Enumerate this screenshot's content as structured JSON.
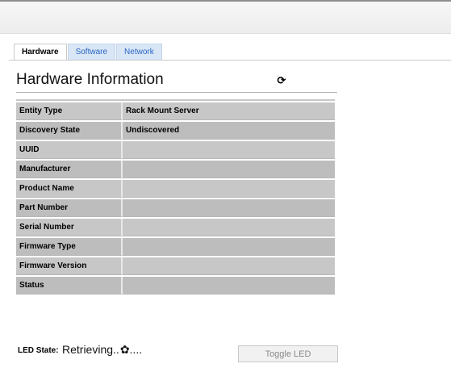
{
  "tabs": [
    "Hardware",
    "Software",
    "Network"
  ],
  "title": "Hardware Information",
  "rows": [
    {
      "label": "Entity Type",
      "value": "Rack Mount Server"
    },
    {
      "label": "Discovery State",
      "value": "Undiscovered"
    },
    {
      "label": "UUID",
      "value": ""
    },
    {
      "label": "Manufacturer",
      "value": ""
    },
    {
      "label": "Product Name",
      "value": ""
    },
    {
      "label": "Part Number",
      "value": ""
    },
    {
      "label": "Serial Number",
      "value": ""
    },
    {
      "label": "Firmware Type",
      "value": ""
    },
    {
      "label": "Firmware Version",
      "value": ""
    },
    {
      "label": "Status",
      "value": ""
    }
  ],
  "led": {
    "label": "LED State:",
    "value": "Retrieving..",
    "ellipsis": "....",
    "button": "Toggle LED"
  },
  "icons": {
    "refresh": "refresh-icon",
    "spinner": "loading-spinner-icon"
  },
  "colors": {
    "tab_link": "#2a66c4",
    "row_bg": "#c7c7c7"
  }
}
